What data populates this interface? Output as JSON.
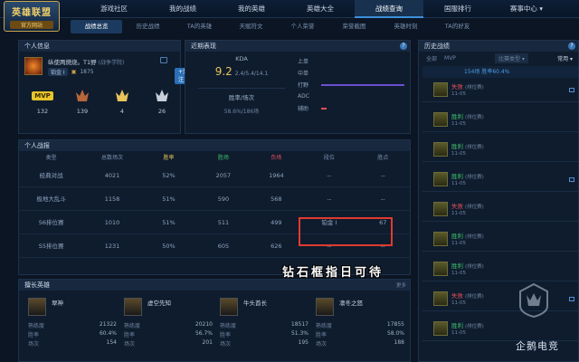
{
  "app": {
    "logo_line1": "英雄联盟",
    "logo_line2": "官方网站"
  },
  "nav": [
    {
      "label": "游戏社区"
    },
    {
      "label": "我的战绩"
    },
    {
      "label": "我的英雄"
    },
    {
      "label": "英雄大全"
    },
    {
      "label": "战绩查询",
      "active": true
    },
    {
      "label": "国服排行"
    },
    {
      "label": "赛事中心 ▾"
    }
  ],
  "subnav": [
    {
      "label": "战绩总览",
      "active": true
    },
    {
      "label": "历史战绩"
    },
    {
      "label": "TA的英雄"
    },
    {
      "label": "天赋符文"
    },
    {
      "label": "个人荣誉"
    },
    {
      "label": "荣誉截图"
    },
    {
      "label": "英雄时刻"
    },
    {
      "label": "TA的好友"
    }
  ],
  "personal": {
    "title": "个人信息",
    "name": "纵使两燃烧。T1野",
    "server": "(战争学院)",
    "tier": "铂金 Ⅰ",
    "currency": "1875",
    "follow": "+关注",
    "badges": [
      {
        "icon": "mvp-badge",
        "label": "MVP",
        "count": "132"
      },
      {
        "icon": "bronze-medal-icon",
        "count": "139"
      },
      {
        "icon": "gold-crown-icon",
        "count": "4"
      },
      {
        "icon": "silver-crown-icon",
        "count": "26"
      }
    ]
  },
  "recent": {
    "title": "近期表现",
    "kda_label": "KDA",
    "kda": "9.2",
    "kda_detail": "2.4/5.4/14.1",
    "wr_label": "胜率/场次",
    "wr_value": "58.6%/186场",
    "lanes": [
      {
        "name": "上单",
        "level": 0.0
      },
      {
        "name": "中单",
        "level": 0.0
      },
      {
        "name": "打野",
        "level": 1.0
      },
      {
        "name": "ADC",
        "level": 0.0
      },
      {
        "name": "辅助",
        "level": 0.06
      }
    ],
    "lane_color": "#6a4fd0",
    "lane_colors": [
      "#6a4fd0",
      "#6a4fd0",
      "#6a4fd0",
      "#6a4fd0",
      "#e0505a"
    ]
  },
  "history": {
    "title": "历史战绩",
    "tabs": [
      "全部",
      "MVP",
      "比赛类型 ▾"
    ],
    "filter": "常用 ▾",
    "summary": "154场 胜率60.4%",
    "rows": [
      {
        "result": "失败",
        "queue": "(排位赛)",
        "date": "11-05"
      },
      {
        "result": "胜利",
        "queue": "(排位赛)",
        "date": "11-05"
      },
      {
        "result": "胜利",
        "queue": "(排位赛)",
        "date": "11-05"
      },
      {
        "result": "胜利",
        "queue": "(排位赛)",
        "date": "11-05"
      },
      {
        "result": "失败",
        "queue": "(排位赛)",
        "date": "11-05"
      },
      {
        "result": "胜利",
        "queue": "(排位赛)",
        "date": "11-05"
      },
      {
        "result": "胜利",
        "queue": "(排位赛)",
        "date": "11-05"
      },
      {
        "result": "失败",
        "queue": "(排位赛)",
        "date": "11-05"
      },
      {
        "result": "胜利",
        "queue": "(排位赛)",
        "date": "11-05"
      }
    ]
  },
  "stats": {
    "title": "个人战报",
    "headers": [
      "类型",
      "总数场次",
      "胜率",
      "胜场",
      "负场",
      "段位",
      "胜点"
    ],
    "rows": [
      [
        "经典对战",
        "4021",
        "52%",
        "2057",
        "1964",
        "--",
        "--"
      ],
      [
        "极地大乱斗",
        "1158",
        "51%",
        "590",
        "568",
        "--",
        "--"
      ],
      [
        "S6排位赛",
        "1010",
        "51%",
        "511",
        "499",
        "铂金 Ⅰ",
        "67"
      ],
      [
        "S5排位赛",
        "1231",
        "50%",
        "605",
        "626",
        "--",
        "--"
      ]
    ]
  },
  "annotation": "钻石框指日可待",
  "heroes": {
    "title": "擅长英雄",
    "more": "更多",
    "list": [
      {
        "name": "翠神",
        "mastery": "21322",
        "winrate": "60.4%",
        "games": "154"
      },
      {
        "name": "虚空先知",
        "mastery": "20210",
        "winrate": "56.7%",
        "games": "201"
      },
      {
        "name": "牛头酋长",
        "mastery": "18517",
        "winrate": "51.3%",
        "games": "195"
      },
      {
        "name": "凛冬之怒",
        "mastery": "17855",
        "winrate": "58.0%",
        "games": "188"
      }
    ],
    "labels": {
      "mastery": "熟练度",
      "winrate": "胜率",
      "games": "场次"
    }
  },
  "watermark": "企鹅电竞"
}
